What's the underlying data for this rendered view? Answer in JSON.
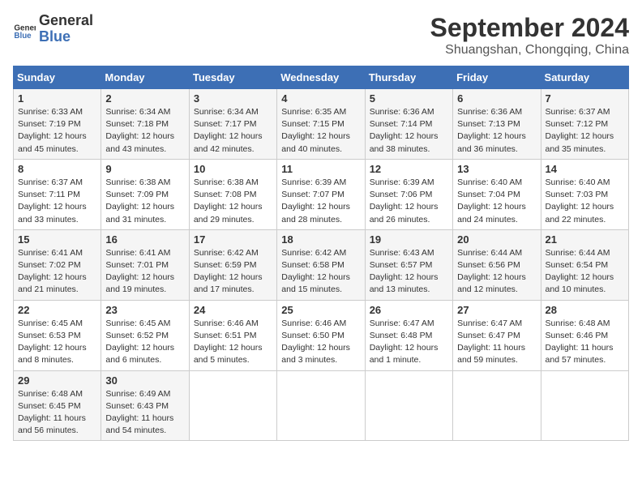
{
  "header": {
    "logo_line1": "General",
    "logo_line2": "Blue",
    "main_title": "September 2024",
    "subtitle": "Shuangshan, Chongqing, China"
  },
  "weekdays": [
    "Sunday",
    "Monday",
    "Tuesday",
    "Wednesday",
    "Thursday",
    "Friday",
    "Saturday"
  ],
  "weeks": [
    [
      {
        "day": "1",
        "sunrise": "6:33 AM",
        "sunset": "7:19 PM",
        "daylight": "12 hours and 45 minutes."
      },
      {
        "day": "2",
        "sunrise": "6:34 AM",
        "sunset": "7:18 PM",
        "daylight": "12 hours and 43 minutes."
      },
      {
        "day": "3",
        "sunrise": "6:34 AM",
        "sunset": "7:17 PM",
        "daylight": "12 hours and 42 minutes."
      },
      {
        "day": "4",
        "sunrise": "6:35 AM",
        "sunset": "7:15 PM",
        "daylight": "12 hours and 40 minutes."
      },
      {
        "day": "5",
        "sunrise": "6:36 AM",
        "sunset": "7:14 PM",
        "daylight": "12 hours and 38 minutes."
      },
      {
        "day": "6",
        "sunrise": "6:36 AM",
        "sunset": "7:13 PM",
        "daylight": "12 hours and 36 minutes."
      },
      {
        "day": "7",
        "sunrise": "6:37 AM",
        "sunset": "7:12 PM",
        "daylight": "12 hours and 35 minutes."
      }
    ],
    [
      {
        "day": "8",
        "sunrise": "6:37 AM",
        "sunset": "7:11 PM",
        "daylight": "12 hours and 33 minutes."
      },
      {
        "day": "9",
        "sunrise": "6:38 AM",
        "sunset": "7:09 PM",
        "daylight": "12 hours and 31 minutes."
      },
      {
        "day": "10",
        "sunrise": "6:38 AM",
        "sunset": "7:08 PM",
        "daylight": "12 hours and 29 minutes."
      },
      {
        "day": "11",
        "sunrise": "6:39 AM",
        "sunset": "7:07 PM",
        "daylight": "12 hours and 28 minutes."
      },
      {
        "day": "12",
        "sunrise": "6:39 AM",
        "sunset": "7:06 PM",
        "daylight": "12 hours and 26 minutes."
      },
      {
        "day": "13",
        "sunrise": "6:40 AM",
        "sunset": "7:04 PM",
        "daylight": "12 hours and 24 minutes."
      },
      {
        "day": "14",
        "sunrise": "6:40 AM",
        "sunset": "7:03 PM",
        "daylight": "12 hours and 22 minutes."
      }
    ],
    [
      {
        "day": "15",
        "sunrise": "6:41 AM",
        "sunset": "7:02 PM",
        "daylight": "12 hours and 21 minutes."
      },
      {
        "day": "16",
        "sunrise": "6:41 AM",
        "sunset": "7:01 PM",
        "daylight": "12 hours and 19 minutes."
      },
      {
        "day": "17",
        "sunrise": "6:42 AM",
        "sunset": "6:59 PM",
        "daylight": "12 hours and 17 minutes."
      },
      {
        "day": "18",
        "sunrise": "6:42 AM",
        "sunset": "6:58 PM",
        "daylight": "12 hours and 15 minutes."
      },
      {
        "day": "19",
        "sunrise": "6:43 AM",
        "sunset": "6:57 PM",
        "daylight": "12 hours and 13 minutes."
      },
      {
        "day": "20",
        "sunrise": "6:44 AM",
        "sunset": "6:56 PM",
        "daylight": "12 hours and 12 minutes."
      },
      {
        "day": "21",
        "sunrise": "6:44 AM",
        "sunset": "6:54 PM",
        "daylight": "12 hours and 10 minutes."
      }
    ],
    [
      {
        "day": "22",
        "sunrise": "6:45 AM",
        "sunset": "6:53 PM",
        "daylight": "12 hours and 8 minutes."
      },
      {
        "day": "23",
        "sunrise": "6:45 AM",
        "sunset": "6:52 PM",
        "daylight": "12 hours and 6 minutes."
      },
      {
        "day": "24",
        "sunrise": "6:46 AM",
        "sunset": "6:51 PM",
        "daylight": "12 hours and 5 minutes."
      },
      {
        "day": "25",
        "sunrise": "6:46 AM",
        "sunset": "6:50 PM",
        "daylight": "12 hours and 3 minutes."
      },
      {
        "day": "26",
        "sunrise": "6:47 AM",
        "sunset": "6:48 PM",
        "daylight": "12 hours and 1 minute."
      },
      {
        "day": "27",
        "sunrise": "6:47 AM",
        "sunset": "6:47 PM",
        "daylight": "11 hours and 59 minutes."
      },
      {
        "day": "28",
        "sunrise": "6:48 AM",
        "sunset": "6:46 PM",
        "daylight": "11 hours and 57 minutes."
      }
    ],
    [
      {
        "day": "29",
        "sunrise": "6:48 AM",
        "sunset": "6:45 PM",
        "daylight": "11 hours and 56 minutes."
      },
      {
        "day": "30",
        "sunrise": "6:49 AM",
        "sunset": "6:43 PM",
        "daylight": "11 hours and 54 minutes."
      },
      null,
      null,
      null,
      null,
      null
    ]
  ]
}
